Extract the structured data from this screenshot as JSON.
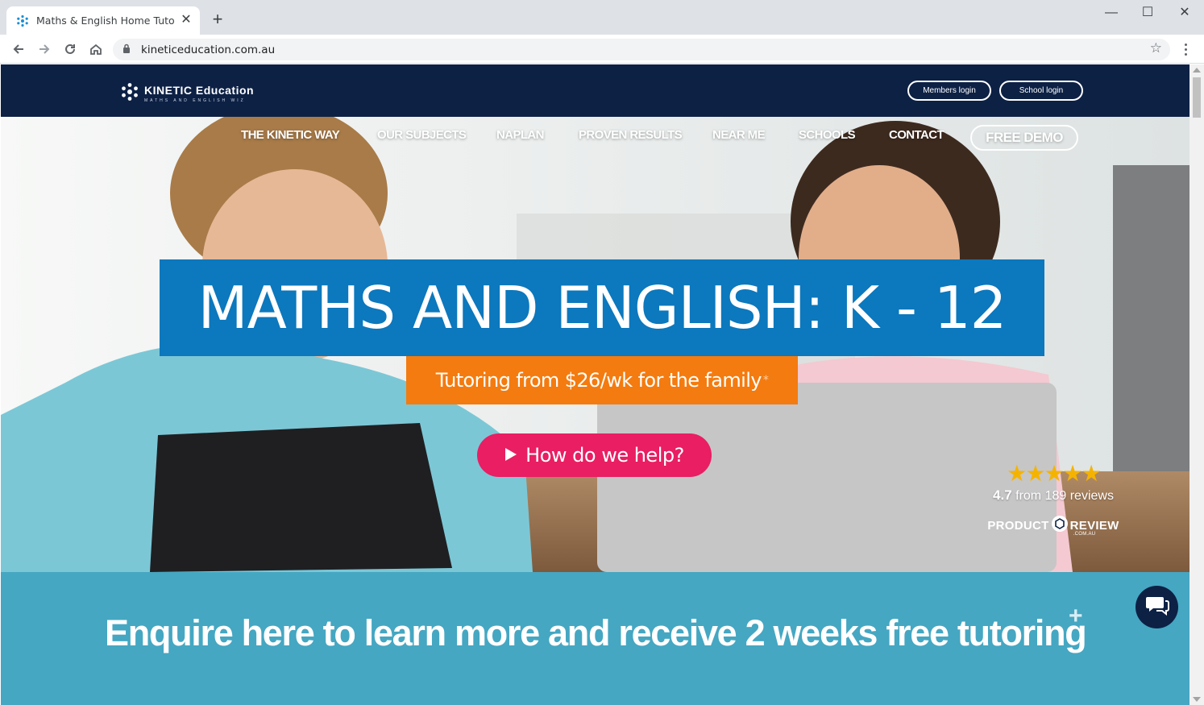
{
  "browser": {
    "tab_title": "Maths & English Home Tutoring",
    "tab_close": "✕",
    "new_tab": "+",
    "url": "kineticeducation.com.au",
    "window_controls": {
      "minimize": "—",
      "maximize": "☐",
      "close": "✕"
    }
  },
  "site": {
    "logo_title": "KINETIC Education",
    "logo_subtitle": "MATHS AND ENGLISH WIZ",
    "members_login": "Members login",
    "school_login": "School login"
  },
  "nav": {
    "items": [
      "THE KINETIC WAY",
      "OUR SUBJECTS",
      "NAPLAN",
      "PROVEN RESULTS",
      "NEAR ME",
      "SCHOOLS",
      "CONTACT"
    ],
    "cta": "FREE DEMO"
  },
  "hero": {
    "headline": "MATHS AND ENGLISH: K - 12",
    "price_text": "Tutoring from $26/wk for the family",
    "price_mark": "*",
    "help_button": "How do we help?",
    "rating": {
      "stars": "★★★★★",
      "score": "4.7",
      "reviews_text": "from 189 reviews",
      "provider_left": "PRODUCT",
      "provider_right": "REVIEW",
      "provider_sub": ".COM.AU"
    }
  },
  "enquire": {
    "text": "Enquire here to learn more and receive 2 weeks free tutoring",
    "mark": "+"
  },
  "colors": {
    "header_navy": "#0d2145",
    "headline_blue": "#0c78bd",
    "price_orange": "#f47b0f",
    "help_pink": "#e91e63",
    "enquire_teal": "#45a7c2",
    "star_gold": "#f5b301"
  }
}
